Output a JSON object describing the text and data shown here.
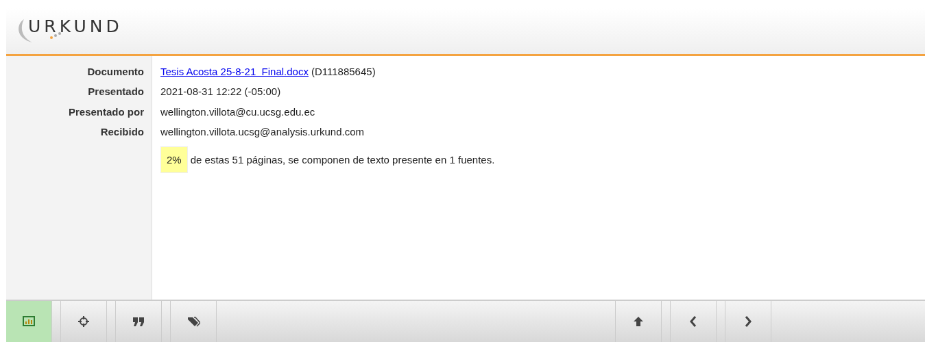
{
  "header": {
    "logo": "URKUND"
  },
  "details": [
    {
      "label": "Documento",
      "kind": "link",
      "link": "Tesis Acosta 25-8-21  Final.docx",
      "value": "(D111885645)"
    },
    {
      "label": "Presentado",
      "kind": "text",
      "value": "2021-08-31 12:22 (-05:00)"
    },
    {
      "label": "Presentado por",
      "kind": "text",
      "value": "wellington.villota@cu.ucsg.edu.ec"
    },
    {
      "label": "Recibido",
      "kind": "text",
      "value": "wellington.villota.ucsg@analysis.urkund.com"
    }
  ],
  "summary": {
    "percent": "2%",
    "text": "de estas 51 páginas, se componen de texto presente en 1 fuentes."
  },
  "toolbar": {
    "left": [
      {
        "kind": "chart",
        "selected": true
      },
      {
        "kind": "target",
        "selected": false
      },
      {
        "kind": "quote",
        "selected": false
      },
      {
        "kind": "tags",
        "selected": false
      }
    ],
    "right": [
      {
        "kind": "up",
        "selected": false
      },
      {
        "kind": "left",
        "selected": false
      },
      {
        "kind": "right",
        "selected": false
      }
    ]
  }
}
